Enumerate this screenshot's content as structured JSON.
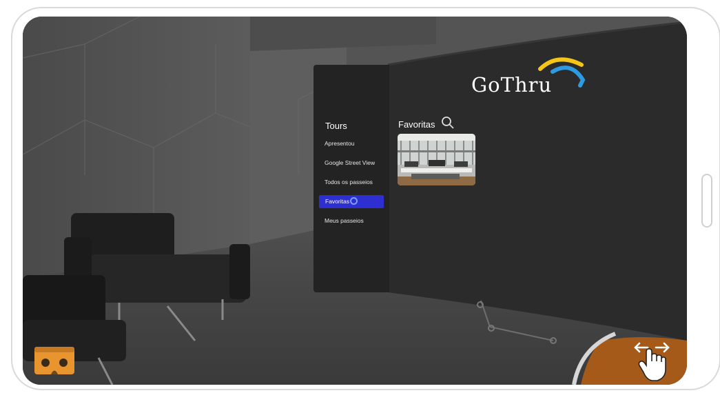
{
  "panel": {
    "brand": "GoThru",
    "nav_title": "Tours",
    "nav_items": [
      {
        "label": "Apresentou"
      },
      {
        "label": "Google Street View"
      },
      {
        "label": "Todos os passeios"
      },
      {
        "label": "Favoritas"
      },
      {
        "label": "Meus passeios"
      }
    ],
    "active_item": "Favoritas",
    "section_title": "Favoritas"
  },
  "icons": {
    "search": "search-icon",
    "cardboard": "cardboard-vr-icon",
    "pan": "drag-pan-hand-icon"
  },
  "colors": {
    "active_nav": "#2d2fd1",
    "panel_bg": "#2a2a2a",
    "logo_yellow": "#f5c518",
    "logo_blue": "#2e9be0",
    "cardboard_orange": "#e8952f"
  }
}
